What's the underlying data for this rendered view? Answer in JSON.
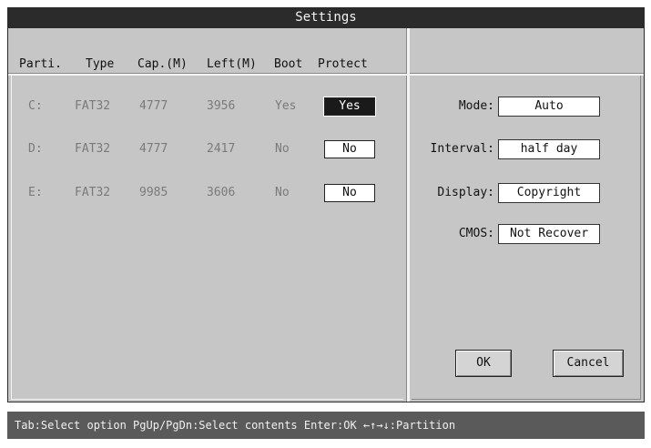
{
  "window": {
    "title": "Settings"
  },
  "table": {
    "headers": [
      "Parti.",
      "Type",
      "Cap.(M)",
      "Left(M)",
      "Boot",
      "Protect"
    ],
    "rows": [
      {
        "partition": "C:",
        "type": "FAT32",
        "capacity": "4777",
        "left": "3956",
        "boot": "Yes",
        "protect": "Yes"
      },
      {
        "partition": "D:",
        "type": "FAT32",
        "capacity": "4777",
        "left": "2417",
        "boot": "No",
        "protect": "No"
      },
      {
        "partition": "E:",
        "type": "FAT32",
        "capacity": "9985",
        "left": "3606",
        "boot": "No",
        "protect": "No"
      }
    ]
  },
  "options": {
    "mode": {
      "label": "Mode:",
      "value": "Auto"
    },
    "interval": {
      "label": "Interval:",
      "value": "half day"
    },
    "display": {
      "label": "Display:",
      "value": "Copyright"
    },
    "cmos": {
      "label": "CMOS:",
      "value": "Not Recover"
    }
  },
  "buttons": {
    "ok": "OK",
    "cancel": "Cancel"
  },
  "status": {
    "text": "Tab:Select option PgUp/PgDn:Select contents Enter:OK ←↑→↓:Partition"
  }
}
